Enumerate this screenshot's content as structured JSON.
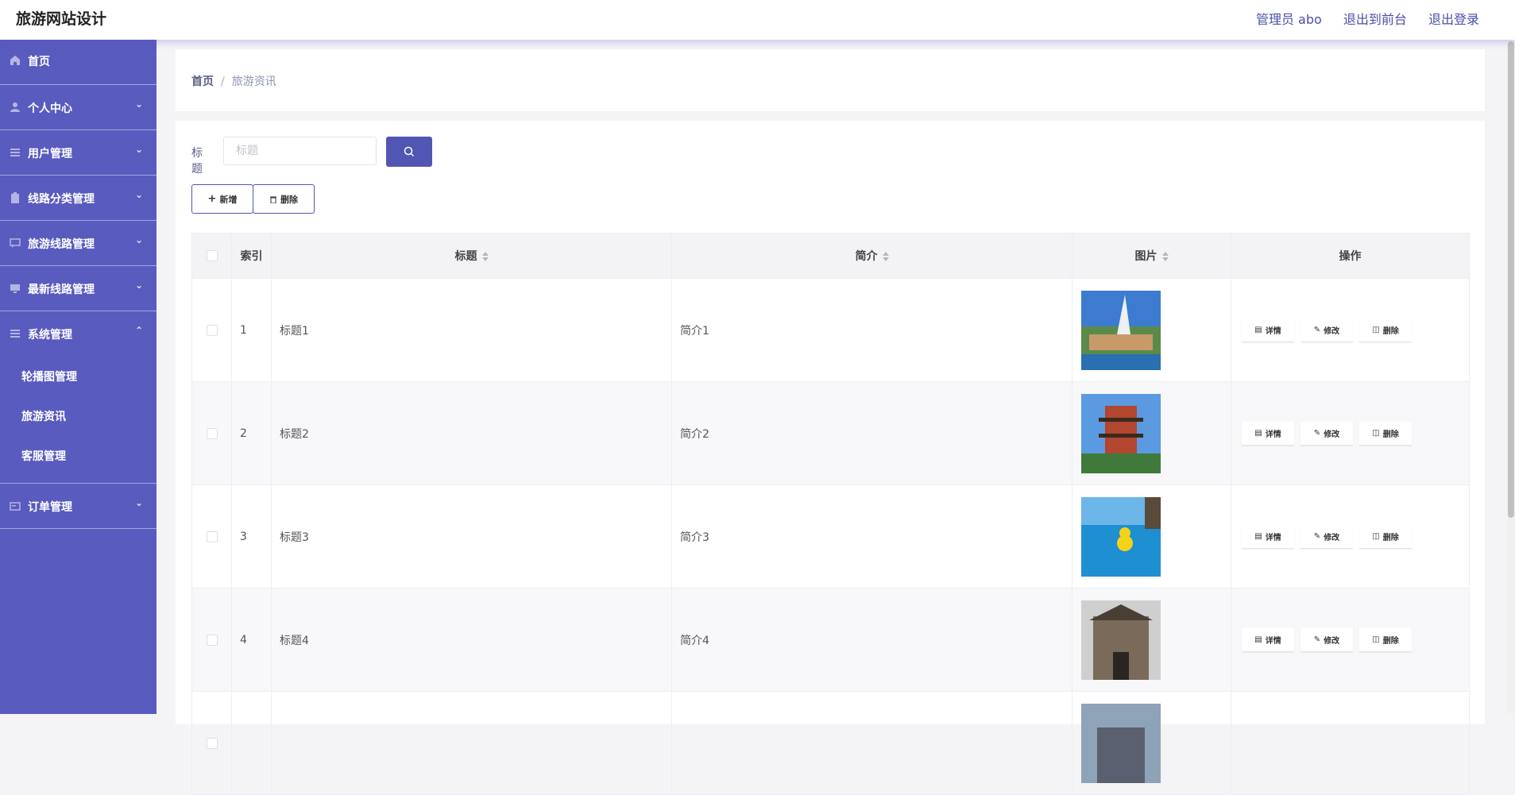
{
  "header": {
    "brand": "旅游网站设计",
    "admin": "管理员 abo",
    "to_front": "退出到前台",
    "logout": "退出登录"
  },
  "sidebar": {
    "items": [
      {
        "label": "首页",
        "icon": "home-icon"
      },
      {
        "label": "个人中心",
        "icon": "user-icon"
      },
      {
        "label": "用户管理",
        "icon": "list-icon"
      },
      {
        "label": "线路分类管理",
        "icon": "clipboard-icon"
      },
      {
        "label": "旅游线路管理",
        "icon": "chat-icon"
      },
      {
        "label": "最新线路管理",
        "icon": "monitor-icon"
      },
      {
        "label": "系统管理",
        "icon": "list-icon"
      },
      {
        "label": "订单管理",
        "icon": "card-icon"
      }
    ],
    "system_sub": [
      "轮播图管理",
      "旅游资讯",
      "客服管理"
    ]
  },
  "breadcrumb": {
    "home": "首页",
    "sep": "/",
    "current": "旅游资讯"
  },
  "search": {
    "label": "标题",
    "placeholder": "标题"
  },
  "actions": {
    "add": "新增",
    "delete": "删除"
  },
  "table": {
    "headers": {
      "index": "索引",
      "title": "标题",
      "intro": "简介",
      "image": "图片",
      "ops": "操作"
    },
    "rows": [
      {
        "index": "1",
        "title": "标题1",
        "intro": "简介1"
      },
      {
        "index": "2",
        "title": "标题2",
        "intro": "简介2"
      },
      {
        "index": "3",
        "title": "标题3",
        "intro": "简介3"
      },
      {
        "index": "4",
        "title": "标题4",
        "intro": "简介4"
      }
    ],
    "op_labels": {
      "detail": "详情",
      "edit": "修改",
      "delete": "删除"
    }
  },
  "colors": {
    "sidebar": "#5a5bbf",
    "accent": "#5156b3"
  }
}
